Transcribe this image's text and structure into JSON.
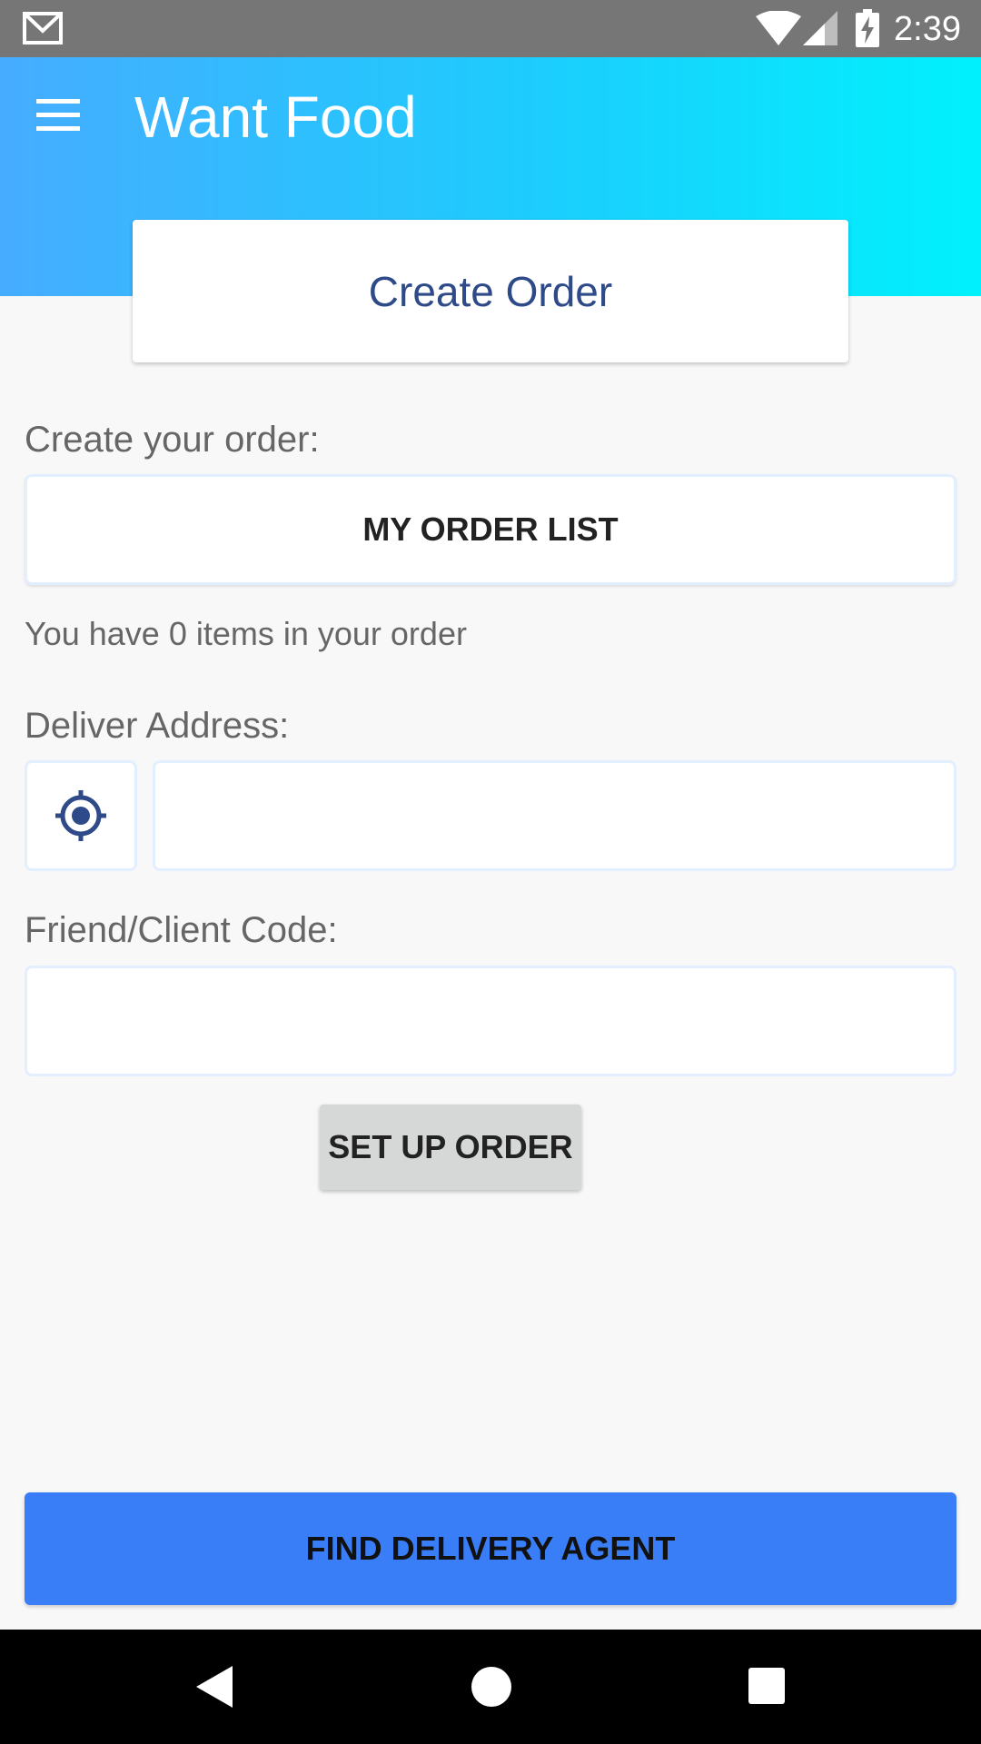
{
  "status_bar": {
    "time": "2:39",
    "icons": [
      "gmail-icon",
      "wifi-icon",
      "cell-signal-icon",
      "battery-charging-icon"
    ]
  },
  "app_bar": {
    "title": "Want Food",
    "menu_icon": "menu-icon",
    "gradient_colors": [
      "#46acff",
      "#1ccdfd",
      "#00f1fd"
    ]
  },
  "header_card": {
    "title": "Create Order"
  },
  "order_section": {
    "label": "Create your order:",
    "button_label": "MY ORDER LIST",
    "items_text": "You have 0 items in your order"
  },
  "address_section": {
    "label": "Deliver Address:",
    "location_icon": "gps-target-icon",
    "input_value": "",
    "input_placeholder": ""
  },
  "code_section": {
    "label": "Friend/Client Code:",
    "input_value": "",
    "input_placeholder": ""
  },
  "setup_button": {
    "label": "SET UP ORDER"
  },
  "find_button": {
    "label": "FIND DELIVERY AGENT",
    "color": "#3a7ef7"
  },
  "nav_bar": {
    "icons": [
      "back-icon",
      "home-icon",
      "recents-icon"
    ]
  }
}
